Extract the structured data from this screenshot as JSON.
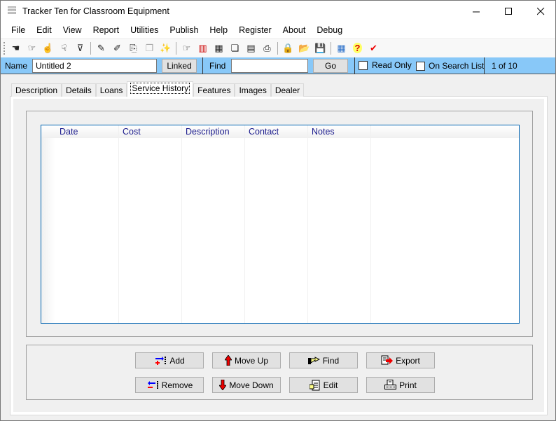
{
  "window": {
    "title": "Tracker Ten for Classroom Equipment",
    "controls": {
      "minimize": "—",
      "maximize": "☐",
      "close": "✕"
    }
  },
  "menu": [
    "File",
    "Edit",
    "View",
    "Report",
    "Utilities",
    "Publish",
    "Help",
    "Register",
    "About",
    "Debug"
  ],
  "toolbar": {
    "groups": [
      [
        {
          "name": "first-record-icon",
          "glyph": "☚"
        },
        {
          "name": "next-record-icon",
          "glyph": "☞"
        },
        {
          "name": "point-up-icon",
          "glyph": "☝"
        },
        {
          "name": "point-down-icon",
          "glyph": "☟"
        },
        {
          "name": "filter-icon",
          "glyph": "⊽"
        }
      ],
      [
        {
          "name": "edit-record-icon",
          "glyph": "✎"
        },
        {
          "name": "brush-icon",
          "glyph": "✐"
        },
        {
          "name": "export-doc-icon",
          "glyph": "⎘"
        },
        {
          "name": "copy-disabled-icon",
          "glyph": "❐"
        },
        {
          "name": "magic-icon",
          "glyph": "✨"
        }
      ],
      [
        {
          "name": "find-icon",
          "glyph": "☞"
        },
        {
          "name": "chart-icon",
          "glyph": "▥"
        },
        {
          "name": "table-icon",
          "glyph": "▦"
        },
        {
          "name": "pages-icon",
          "glyph": "❏"
        },
        {
          "name": "film-icon",
          "glyph": "▤"
        },
        {
          "name": "print-icon",
          "glyph": "⎙"
        }
      ],
      [
        {
          "name": "lock-icon",
          "glyph": "🔒"
        },
        {
          "name": "open-folder-icon",
          "glyph": "📂"
        },
        {
          "name": "save-icon",
          "glyph": "💾"
        }
      ],
      [
        {
          "name": "calculator-icon",
          "glyph": "▦"
        },
        {
          "name": "help-icon",
          "glyph": "?"
        },
        {
          "name": "check-icon",
          "glyph": "✔"
        }
      ]
    ]
  },
  "infobar": {
    "name_label": "Name",
    "name_value": "Untitled 2",
    "linked_label": "Linked",
    "find_label": "Find",
    "find_value": "",
    "go_label": "Go",
    "read_only_label": "Read Only",
    "read_only_checked": false,
    "on_search_list_label": "On Search List",
    "on_search_list_checked": false,
    "record_position": "1 of 10"
  },
  "tabs": [
    {
      "label": "Description",
      "active": false
    },
    {
      "label": "Details",
      "active": false
    },
    {
      "label": "Loans",
      "active": false
    },
    {
      "label": "Service History",
      "active": true
    },
    {
      "label": "Features",
      "active": false
    },
    {
      "label": "Images",
      "active": false
    },
    {
      "label": "Dealer",
      "active": false
    }
  ],
  "grid": {
    "columns": [
      "Date",
      "Cost",
      "Description",
      "Contact",
      "Notes"
    ],
    "rows": []
  },
  "actions": {
    "add": "Add",
    "remove": "Remove",
    "move_up": "Move Up",
    "move_down": "Move Down",
    "find": "Find",
    "edit": "Edit",
    "export": "Export",
    "print": "Print"
  },
  "colors": {
    "infobar_bg": "#88c8f8",
    "grid_border": "#0063b1",
    "column_header_text": "#1a1a8c"
  }
}
